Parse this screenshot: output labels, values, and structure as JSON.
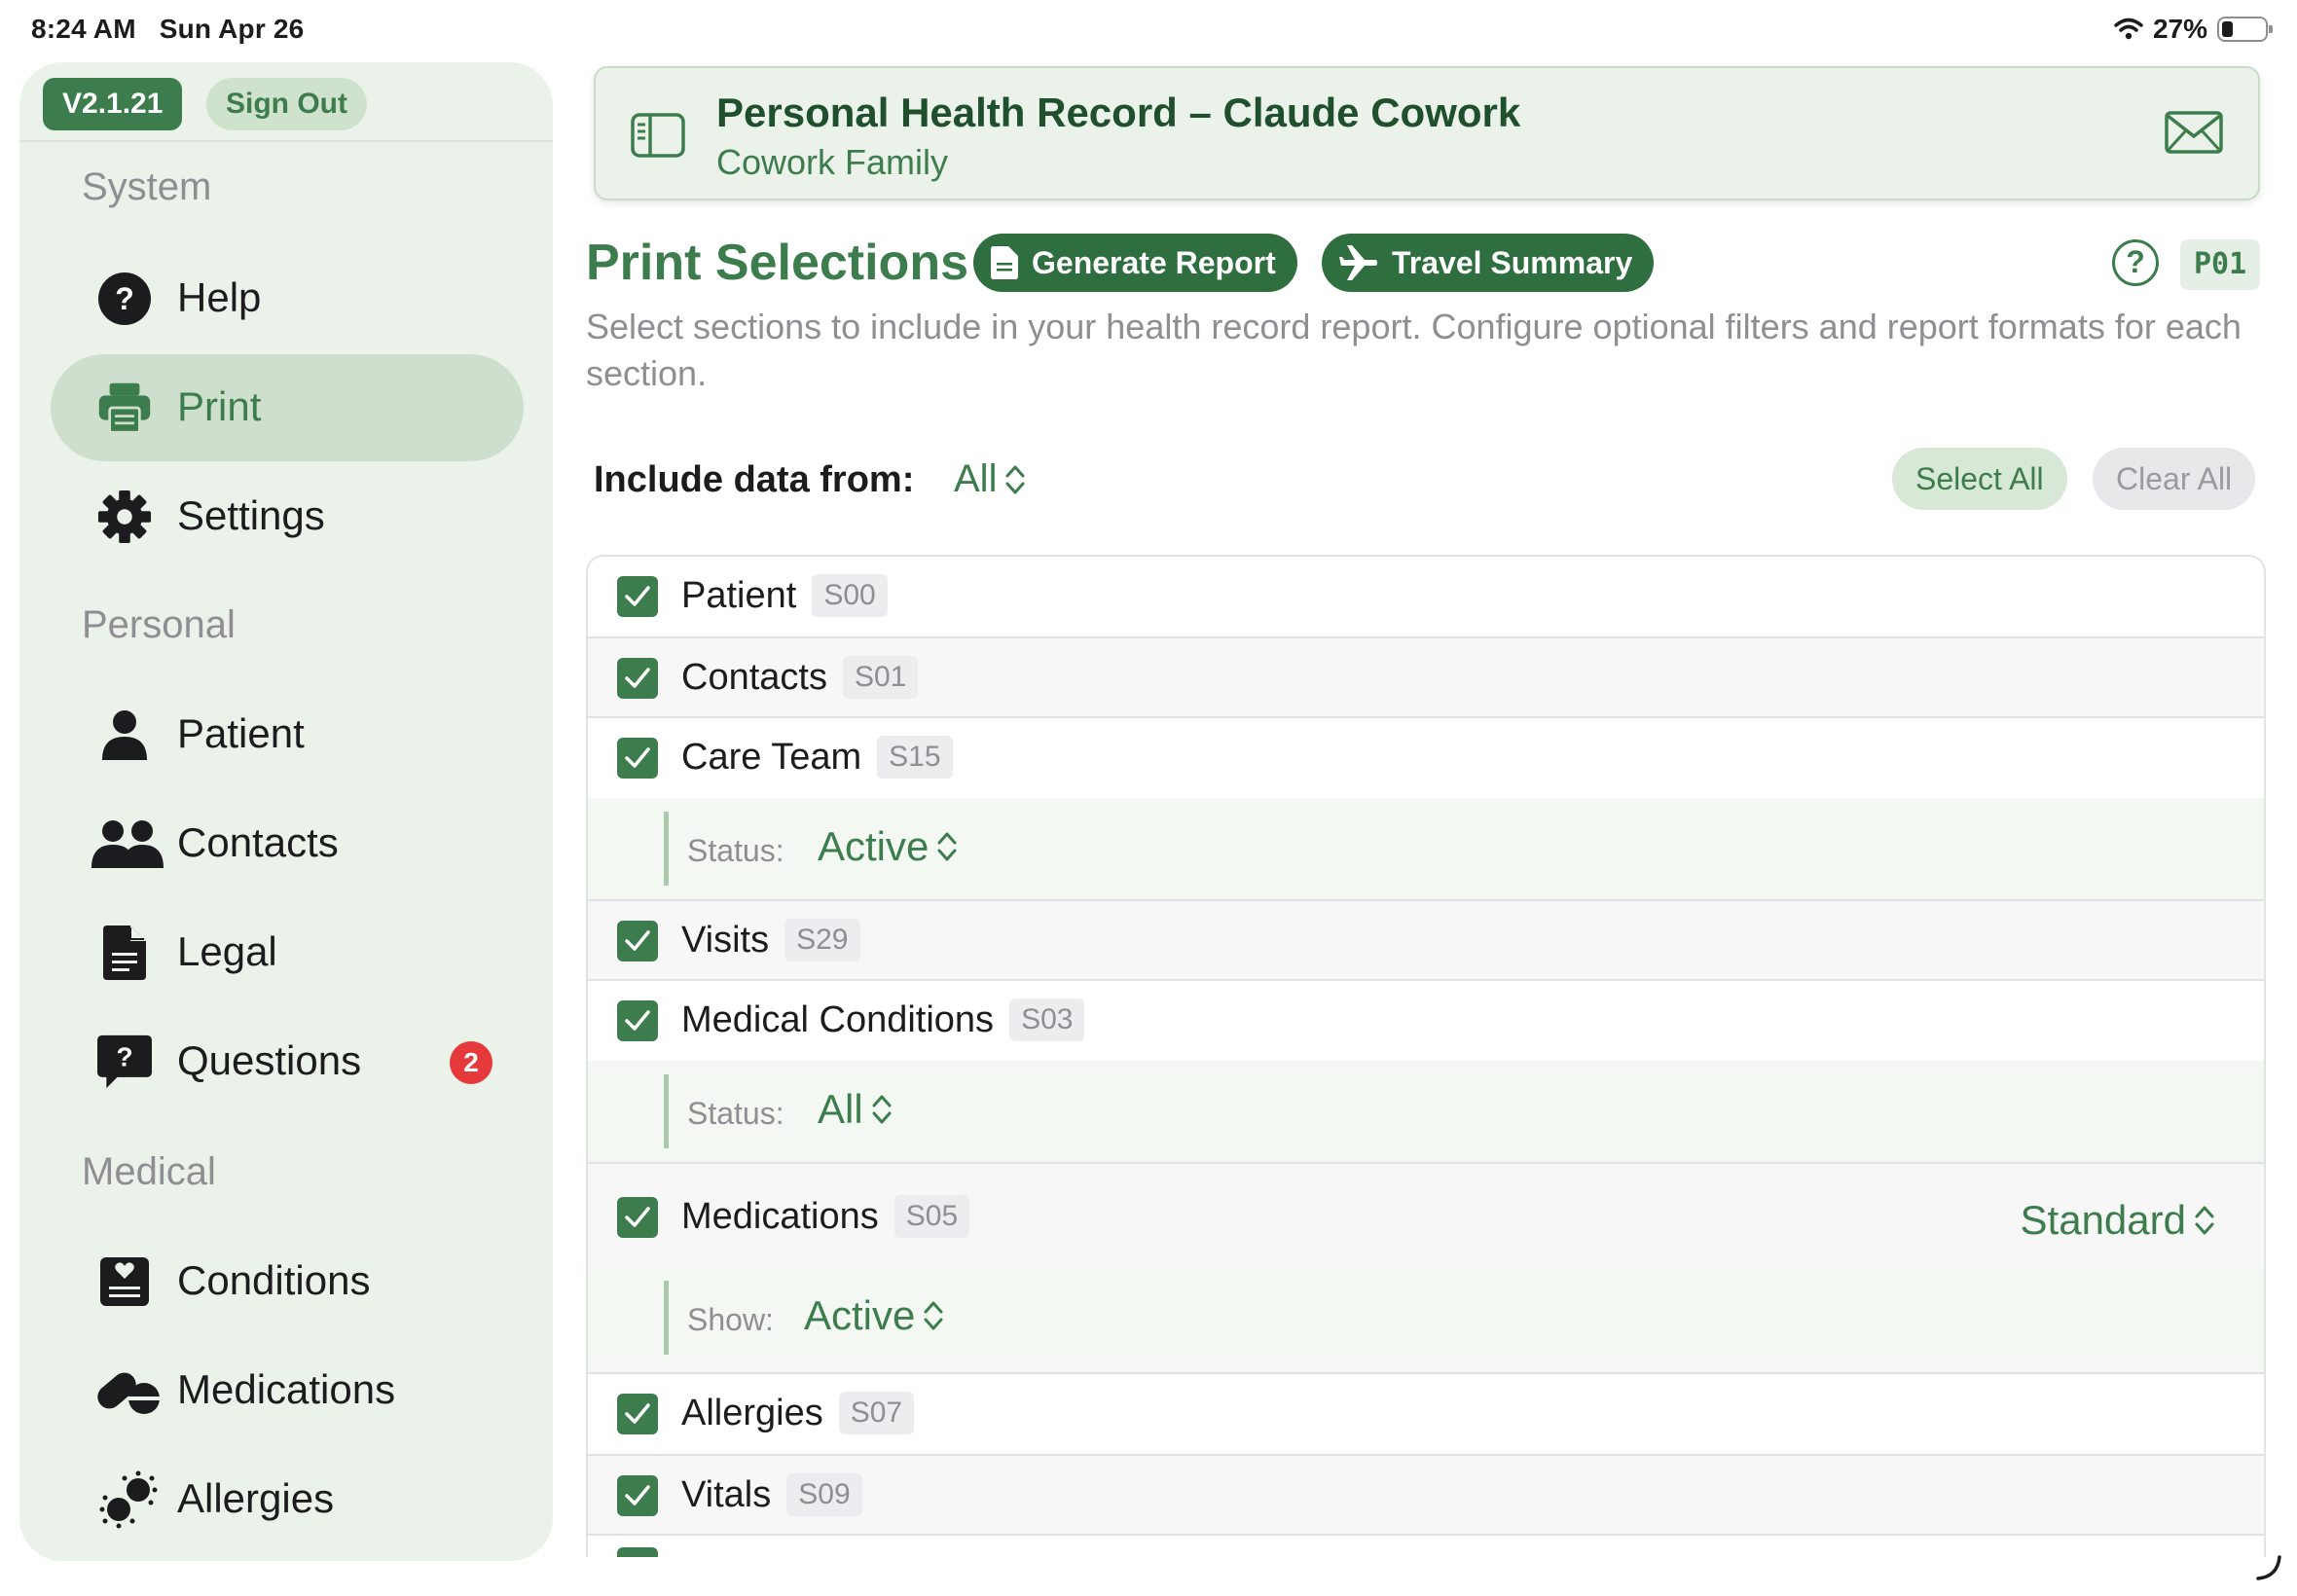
{
  "status_bar": {
    "time": "8:24 AM",
    "date": "Sun Apr 26",
    "battery_percent": "27%",
    "battery_level": 0.27
  },
  "sidebar": {
    "version": "V2.1.21",
    "sign_out_label": "Sign Out",
    "sections": [
      {
        "title": "System",
        "items": [
          {
            "label": "Help",
            "icon": "help-icon"
          },
          {
            "label": "Print",
            "icon": "print-icon",
            "active": true
          },
          {
            "label": "Settings",
            "icon": "gear-icon"
          }
        ]
      },
      {
        "title": "Personal",
        "items": [
          {
            "label": "Patient",
            "icon": "person-icon"
          },
          {
            "label": "Contacts",
            "icon": "people-icon"
          },
          {
            "label": "Legal",
            "icon": "document-icon"
          },
          {
            "label": "Questions",
            "icon": "question-bubble-icon",
            "badge": "2"
          }
        ]
      },
      {
        "title": "Medical",
        "items": [
          {
            "label": "Conditions",
            "icon": "heart-clipboard-icon"
          },
          {
            "label": "Medications",
            "icon": "pills-icon"
          },
          {
            "label": "Allergies",
            "icon": "allergens-icon"
          }
        ]
      }
    ]
  },
  "header": {
    "title": "Personal Health Record – Claude Cowork",
    "subtitle": "Cowork Family"
  },
  "page": {
    "title": "Print Selections",
    "generate_report_label": "Generate Report",
    "travel_summary_label": "Travel Summary",
    "help_symbol": "?",
    "page_code": "P01",
    "description": "Select sections to include in your health record report. Configure optional filters and report formats for each section."
  },
  "filters": {
    "include_label": "Include data from:",
    "include_value": "All",
    "select_all_label": "Select All",
    "clear_all_label": "Clear All"
  },
  "sections": [
    {
      "label": "Patient",
      "code": "S00",
      "checked": true
    },
    {
      "label": "Contacts",
      "code": "S01",
      "checked": true
    },
    {
      "label": "Care Team",
      "code": "S15",
      "checked": true,
      "sub_label": "Status:",
      "sub_value": "Active"
    },
    {
      "label": "Visits",
      "code": "S29",
      "checked": true
    },
    {
      "label": "Medical Conditions",
      "code": "S03",
      "checked": true,
      "sub_label": "Status:",
      "sub_value": "All"
    },
    {
      "label": "Medications",
      "code": "S05",
      "checked": true,
      "format": "Standard",
      "sub_label": "Show:",
      "sub_value": "Active"
    },
    {
      "label": "Allergies",
      "code": "S07",
      "checked": true
    },
    {
      "label": "Vitals",
      "code": "S09",
      "checked": true
    }
  ],
  "colors": {
    "accent": "#3d7d4d",
    "sidebar_bg": "#ebf2ea",
    "badge": "#e5393b"
  }
}
